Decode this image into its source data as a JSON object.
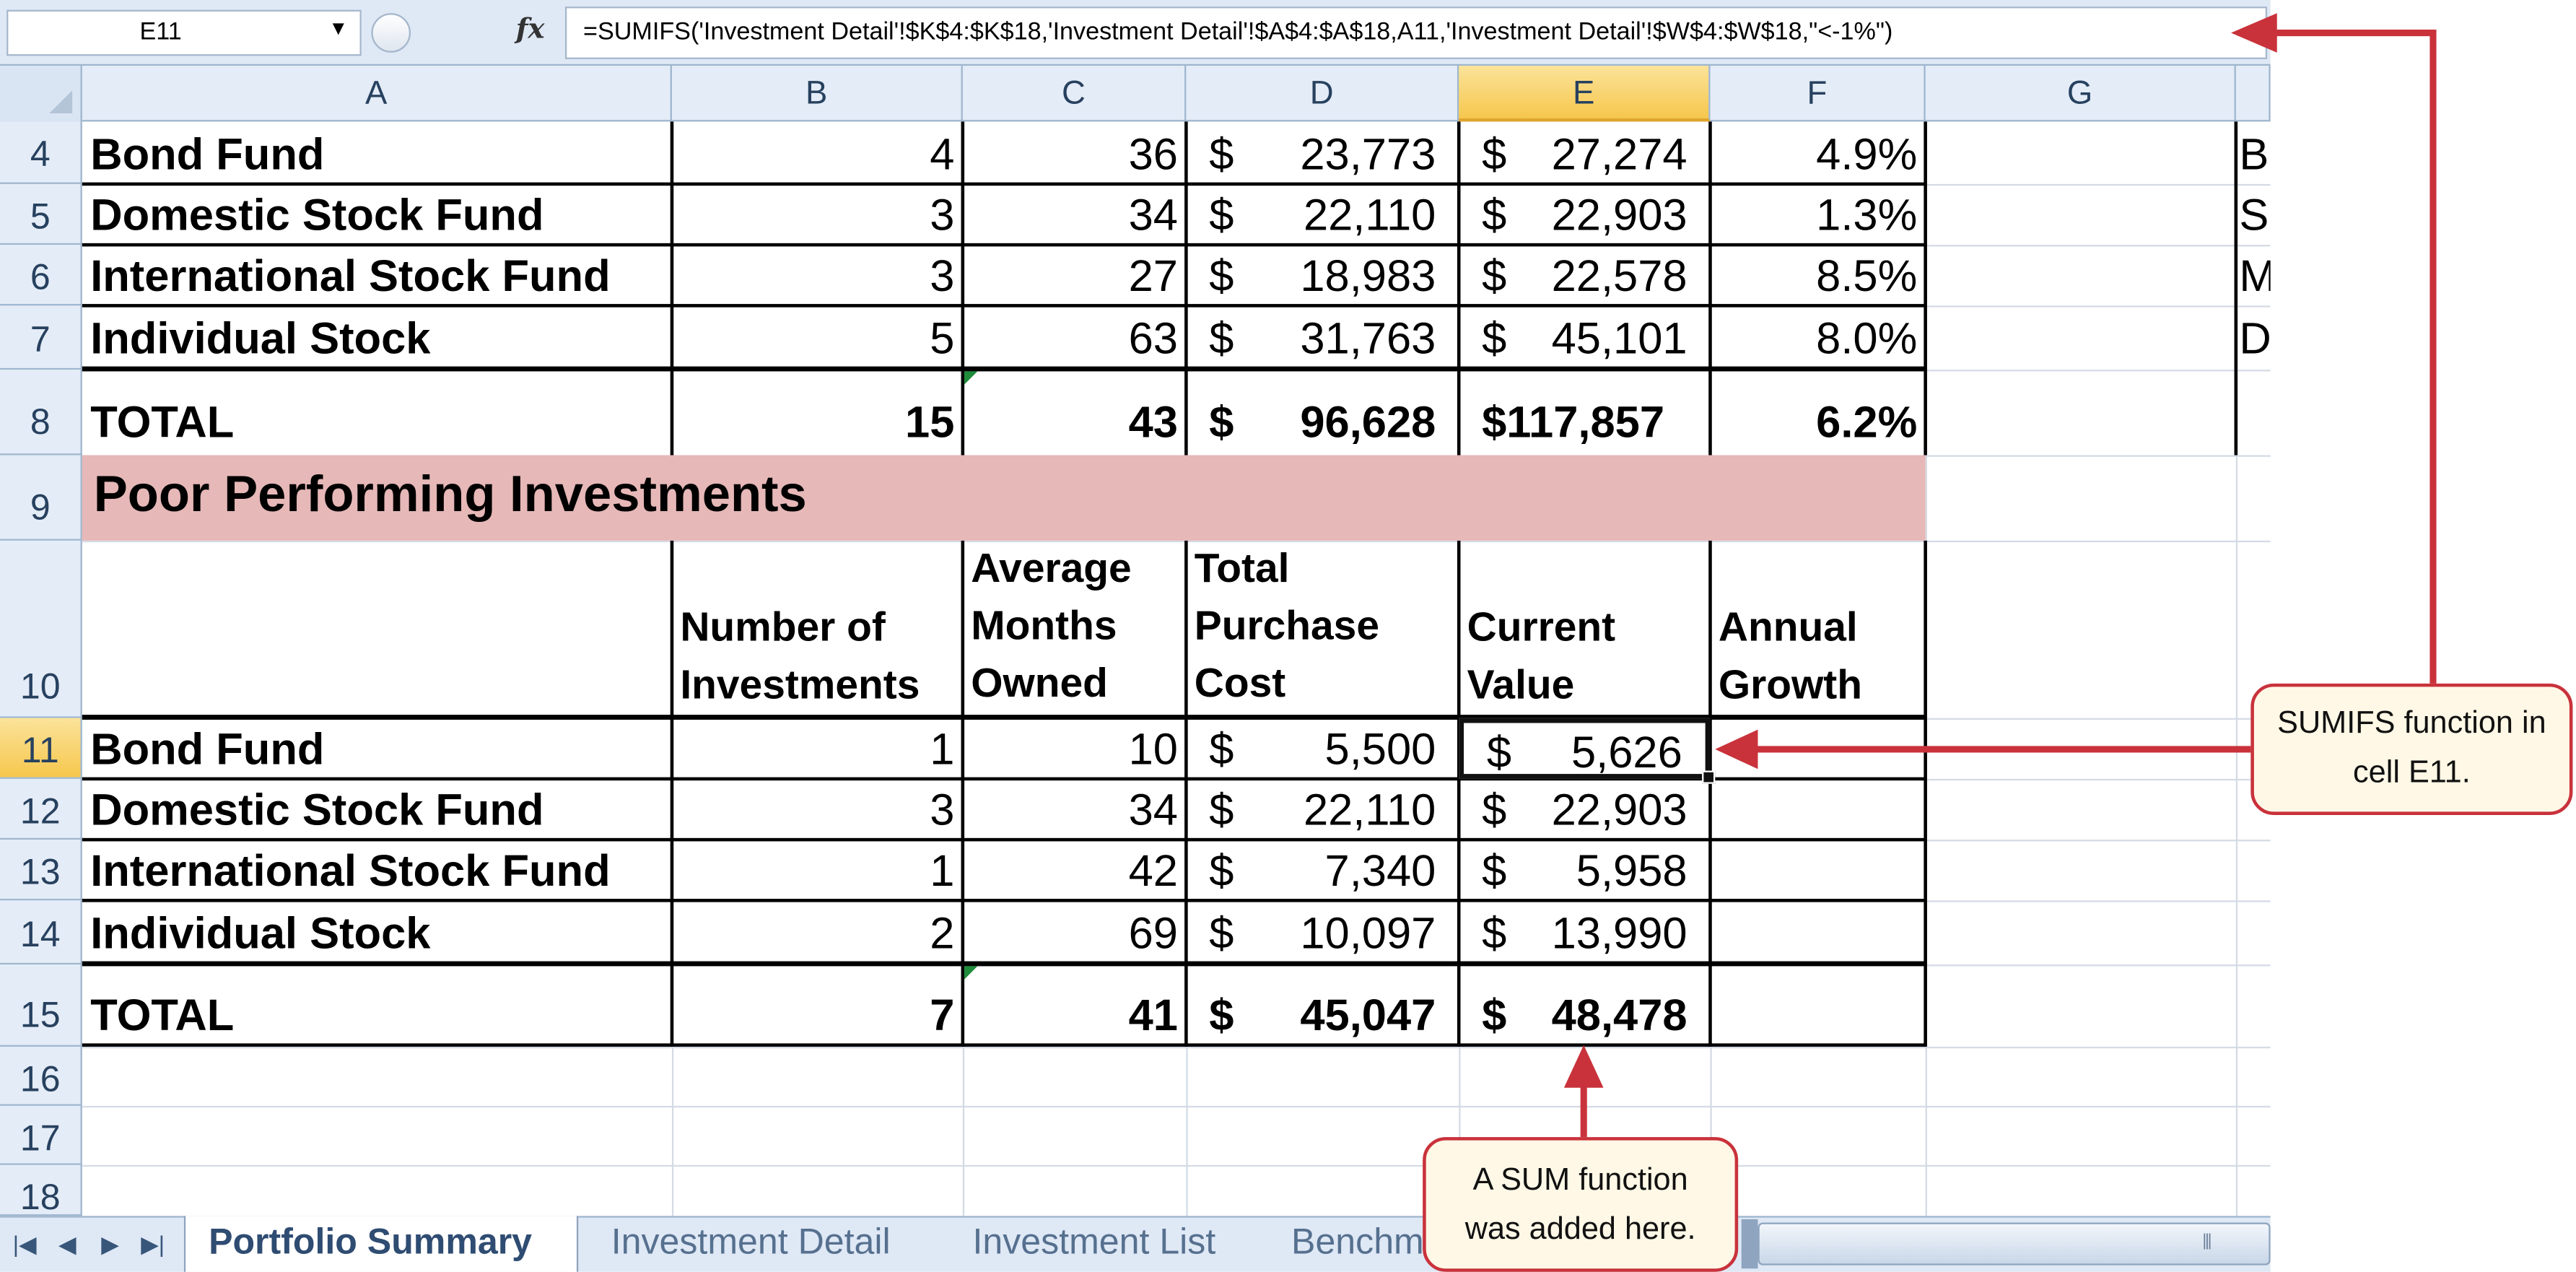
{
  "formula_bar": {
    "name_box": "E11",
    "fx_label": "fx",
    "formula": "=SUMIFS('Investment Detail'!$K$4:$K$18,'Investment Detail'!$A$4:$A$18,A11,'Investment Detail'!$W$4:$W$18,\"<-1%\")"
  },
  "columns": [
    "A",
    "B",
    "C",
    "D",
    "E",
    "F",
    "G"
  ],
  "selected_cell": {
    "column": "E",
    "row": "11"
  },
  "rows_visible": [
    "4",
    "5",
    "6",
    "7",
    "8",
    "9",
    "10",
    "11",
    "12",
    "13",
    "14",
    "15",
    "16",
    "17",
    "18"
  ],
  "top_table": {
    "rows": [
      {
        "label": "Bond Fund",
        "count": "4",
        "months": "36",
        "cost_sym": "$",
        "cost": "23,773",
        "value_sym": "$",
        "value": "27,274",
        "growth": "4.9%",
        "g_text": "B"
      },
      {
        "label": "Domestic Stock Fund",
        "count": "3",
        "months": "34",
        "cost_sym": "$",
        "cost": "22,110",
        "value_sym": "$",
        "value": "22,903",
        "growth": "1.3%",
        "g_text": "S"
      },
      {
        "label": "International Stock Fund",
        "count": "3",
        "months": "27",
        "cost_sym": "$",
        "cost": "18,983",
        "value_sym": "$",
        "value": "22,578",
        "growth": "8.5%",
        "g_text": "M"
      },
      {
        "label": "Individual Stock",
        "count": "5",
        "months": "63",
        "cost_sym": "$",
        "cost": "31,763",
        "value_sym": "$",
        "value": "45,101",
        "growth": "8.0%",
        "g_text": "D"
      }
    ],
    "total": {
      "label": "TOTAL",
      "count": "15",
      "months": "43",
      "cost_sym": "$",
      "cost": "96,628",
      "value": "$117,857",
      "growth": "6.2%"
    }
  },
  "poor_section": {
    "title": "Poor Performing Investments",
    "headers": {
      "count": [
        "Number of",
        "Investments"
      ],
      "months": [
        "Average",
        "Months",
        "Owned"
      ],
      "cost": [
        "Total",
        "Purchase",
        "Cost"
      ],
      "value": [
        "Current",
        "Value"
      ],
      "growth": [
        "Annual",
        "Growth"
      ]
    },
    "rows": [
      {
        "label": "Bond Fund",
        "count": "1",
        "months": "10",
        "cost_sym": "$",
        "cost": "5,500",
        "value_sym": "$",
        "value": "5,626"
      },
      {
        "label": "Domestic Stock Fund",
        "count": "3",
        "months": "34",
        "cost_sym": "$",
        "cost": "22,110",
        "value_sym": "$",
        "value": "22,903"
      },
      {
        "label": "International Stock Fund",
        "count": "1",
        "months": "42",
        "cost_sym": "$",
        "cost": "7,340",
        "value_sym": "$",
        "value": "5,958"
      },
      {
        "label": "Individual Stock",
        "count": "2",
        "months": "69",
        "cost_sym": "$",
        "cost": "10,097",
        "value_sym": "$",
        "value": "13,990"
      }
    ],
    "total": {
      "label": "TOTAL",
      "count": "7",
      "months": "41",
      "cost_sym": "$",
      "cost": "45,047",
      "value_sym": "$",
      "value": "48,478"
    }
  },
  "sheet_tabs": [
    "Portfolio Summary",
    "Investment Detail",
    "Investment List",
    "Benchma"
  ],
  "active_tab": "Portfolio Summary",
  "callouts": {
    "sumifs": "SUMIFS function in cell E11.",
    "sum": "A SUM function was added here."
  },
  "colors": {
    "accent_red": "#c9323b",
    "title_band": "#e6b8b7",
    "callout_fill": "#fff8e6",
    "selected_header": "#f6c74d"
  }
}
